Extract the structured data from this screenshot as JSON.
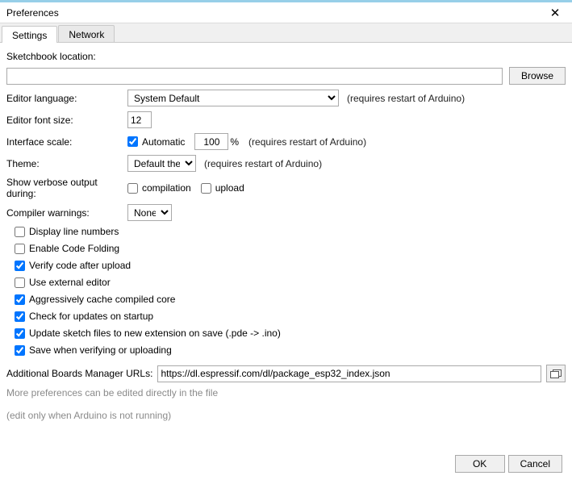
{
  "window": {
    "title": "Preferences"
  },
  "tabs": {
    "settings": "Settings",
    "network": "Network"
  },
  "labels": {
    "sketchbook": "Sketchbook location:",
    "editorLanguage": "Editor language:",
    "editorFontSize": "Editor font size:",
    "interfaceScale": "Interface scale:",
    "theme": "Theme:",
    "verbose": "Show verbose output during:",
    "compilerWarnings": "Compiler warnings:",
    "additionalUrls": "Additional Boards Manager URLs:",
    "morePrefs": "More preferences can be edited directly in the file",
    "editOnly": "(edit only when Arduino is not running)",
    "restart": "(requires restart of Arduino)",
    "percent": "%"
  },
  "values": {
    "sketchbook": "",
    "editorLanguage": "System Default",
    "fontSize": "12",
    "scaleAuto": true,
    "scaleAutoLabel": "Automatic",
    "scaleValue": "100",
    "theme": "Default theme",
    "warnings": "None",
    "boardsUrl": "https://dl.espressif.com/dl/package_esp32_index.json"
  },
  "verbose": {
    "compileLabel": "compilation",
    "uploadLabel": "upload",
    "compile": false,
    "upload": false
  },
  "options": {
    "displayLineNumbers": {
      "label": "Display line numbers",
      "checked": false
    },
    "codeFolding": {
      "label": "Enable Code Folding",
      "checked": false
    },
    "verifyAfterUpload": {
      "label": "Verify code after upload",
      "checked": true
    },
    "externalEditor": {
      "label": "Use external editor",
      "checked": false
    },
    "cacheCore": {
      "label": "Aggressively cache compiled core",
      "checked": true
    },
    "checkUpdates": {
      "label": "Check for updates on startup",
      "checked": true
    },
    "updateExt": {
      "label": "Update sketch files to new extension on save (.pde -> .ino)",
      "checked": true
    },
    "saveVerify": {
      "label": "Save when verifying or uploading",
      "checked": true
    }
  },
  "buttons": {
    "browse": "Browse",
    "ok": "OK",
    "cancel": "Cancel"
  }
}
